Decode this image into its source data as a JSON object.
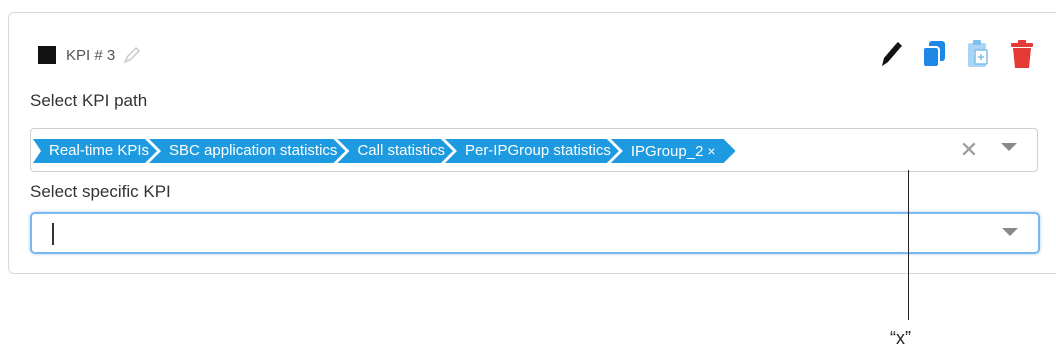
{
  "kpi": {
    "title": "KPI # 3",
    "swatch_color": "#111111",
    "icons": {
      "rename": "pencil-outline-icon",
      "edit": "pen-icon",
      "copy": "copy-icon",
      "paste": "paste-icon",
      "delete": "trash-icon"
    }
  },
  "path": {
    "label": "Select KPI path",
    "crumbs": [
      "Real-time KPIs",
      "SBC application statistics",
      "Call statistics",
      "Per-IPGroup statistics",
      "IPGroup_2"
    ],
    "remove_symbol": "×",
    "clear_symbol": "✕"
  },
  "specific": {
    "label": "Select specific KPI",
    "value": ""
  },
  "annotation": {
    "label": "“x”"
  },
  "colors": {
    "crumb": "#1e9ae0",
    "action_blue": "#1e88e5",
    "delete_red": "#e53935"
  }
}
